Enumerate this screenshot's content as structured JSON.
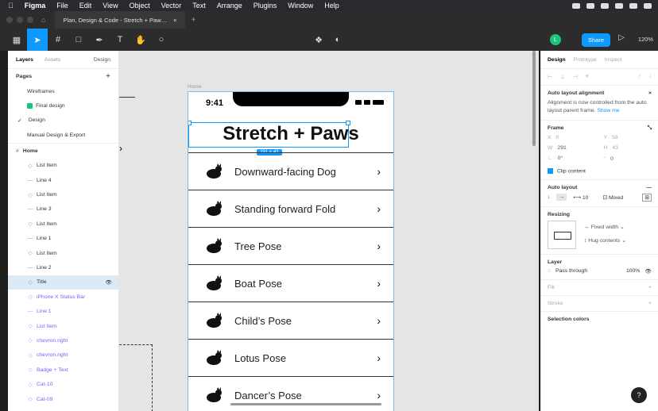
{
  "menubar": {
    "items": [
      "Figma",
      "File",
      "Edit",
      "View",
      "Object",
      "Vector",
      "Text",
      "Arrange",
      "Plugins",
      "Window",
      "Help"
    ]
  },
  "tab": {
    "title": "Plan, Design & Code - Stretch + Paw…"
  },
  "toolbar": {
    "avatar": "L",
    "share_label": "Share",
    "zoom": "120%"
  },
  "layers_panel": {
    "tab_layers": "Layers",
    "tab_assets": "Assets",
    "page_select": "Design",
    "pages_title": "Pages",
    "pages": [
      "Wireframes",
      "Final design",
      "Design",
      "Manual Design & Export"
    ],
    "home_section": "Home",
    "layers": [
      {
        "label": "List Item",
        "selected": false,
        "purple": false
      },
      {
        "label": "Line 4",
        "selected": false,
        "purple": false
      },
      {
        "label": "List Item",
        "selected": false,
        "purple": false
      },
      {
        "label": "Line 3",
        "selected": false,
        "purple": false
      },
      {
        "label": "List Item",
        "selected": false,
        "purple": false
      },
      {
        "label": "Line 1",
        "selected": false,
        "purple": false
      },
      {
        "label": "List Item",
        "selected": false,
        "purple": false
      },
      {
        "label": "Line 2",
        "selected": false,
        "purple": false
      },
      {
        "label": "Title",
        "selected": true,
        "purple": false
      },
      {
        "label": "iPhone X Status Bar",
        "selected": false,
        "purple": true
      },
      {
        "label": "Line 1",
        "selected": false,
        "purple": true
      },
      {
        "label": "List Item",
        "selected": false,
        "purple": true
      },
      {
        "label": "chevron.right",
        "selected": false,
        "purple": true
      },
      {
        "label": "chevron.right",
        "selected": false,
        "purple": true
      },
      {
        "label": "Badge + Text",
        "selected": false,
        "purple": true
      },
      {
        "label": "Cat-10",
        "selected": false,
        "purple": true
      },
      {
        "label": "Cat-09",
        "selected": false,
        "purple": true
      }
    ]
  },
  "canvas": {
    "frame_label": "Home",
    "status_time": "9:41",
    "title": "Stretch + Paws",
    "dimension_badge": "291 × 43",
    "items": [
      "Downward-facing Dog",
      "Standing forward Fold",
      "Tree Pose",
      "Boat Pose",
      "Child’s Pose",
      "Lotus Pose",
      "Dancer’s Pose"
    ]
  },
  "design_panel": {
    "tab_design": "Design",
    "tab_prototype": "Prototype",
    "tab_inspect": "Inspect",
    "auto_layout_alignment": "Auto layout alignment",
    "alignment_note": "Alignment is now controlled from the auto layout parent frame.",
    "show_me": "Show me",
    "frame_title": "Frame",
    "x": "0",
    "y": "58",
    "w": "291",
    "h": "43",
    "rotation": "0°",
    "radius": "0",
    "clip_content": "Clip content",
    "auto_layout_title": "Auto layout",
    "gap": "10",
    "padding_mode": "Mixed",
    "resizing_title": "Resizing",
    "fixed_width": "Fixed width",
    "hug_contents": "Hug contents",
    "layer_title": "Layer",
    "blend_mode": "Pass through",
    "opacity": "100%",
    "fill_title": "Fill",
    "stroke_title": "Stroke",
    "selection_colors": "Selection colors",
    "help": "?"
  }
}
